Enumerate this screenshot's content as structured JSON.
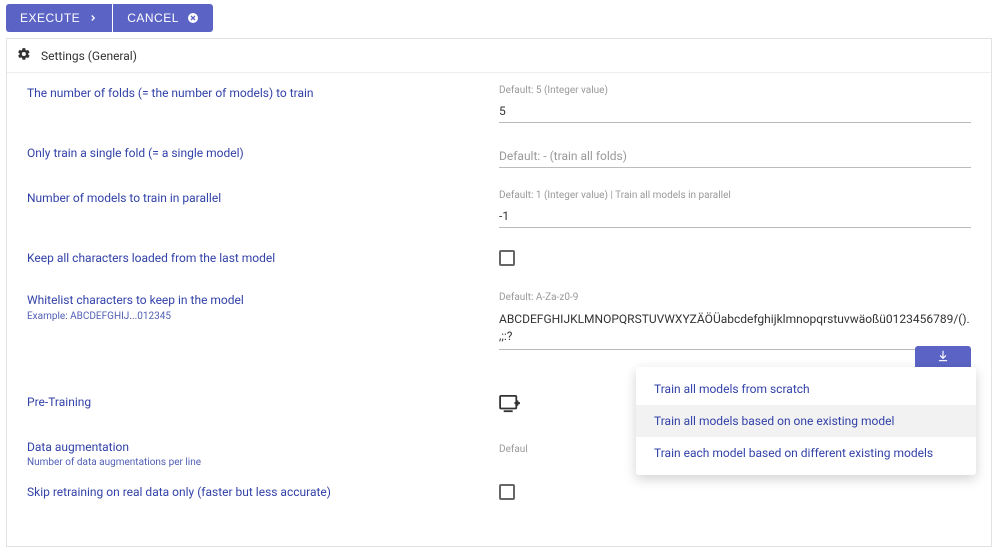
{
  "buttons": {
    "execute": "EXECUTE",
    "cancel": "CANCEL"
  },
  "panel": {
    "title": "Settings (General)"
  },
  "fields": {
    "folds": {
      "label": "The number of folds (= the number of models) to train",
      "hint": "Default: 5 (Integer value)",
      "value": "5"
    },
    "single_fold": {
      "label": "Only train a single fold (= a single model)",
      "placeholder": "Default: - (train all folds)"
    },
    "parallel": {
      "label": "Number of models to train in parallel",
      "hint": "Default: 1 (Integer value) | Train all models in parallel",
      "value": "-1"
    },
    "keep_chars": {
      "label": "Keep all characters loaded from the last model"
    },
    "whitelist": {
      "label": "Whitelist characters to keep in the model",
      "sublabel": "Example: ABCDEFGHIJ...012345",
      "hint": "Default: A-Za-z0-9",
      "value": "ABCDEFGHIJKLMNOPQRSTUVWXYZÄÖÜabcdefghijklmnopqrstuvwäoßü0123456789/().,;:?"
    },
    "pretraining": {
      "label": "Pre-Training"
    },
    "augmentation": {
      "label": "Data augmentation",
      "sublabel": "Number of data augmentations per line",
      "hint_prefix": "Defaul"
    },
    "skip_retrain": {
      "label": "Skip retraining on real data only (faster but less accurate)"
    }
  },
  "dropdown": {
    "opt1": "Train all models from scratch",
    "opt2": "Train all models based on one existing model",
    "opt3": "Train each model based on different existing models"
  }
}
